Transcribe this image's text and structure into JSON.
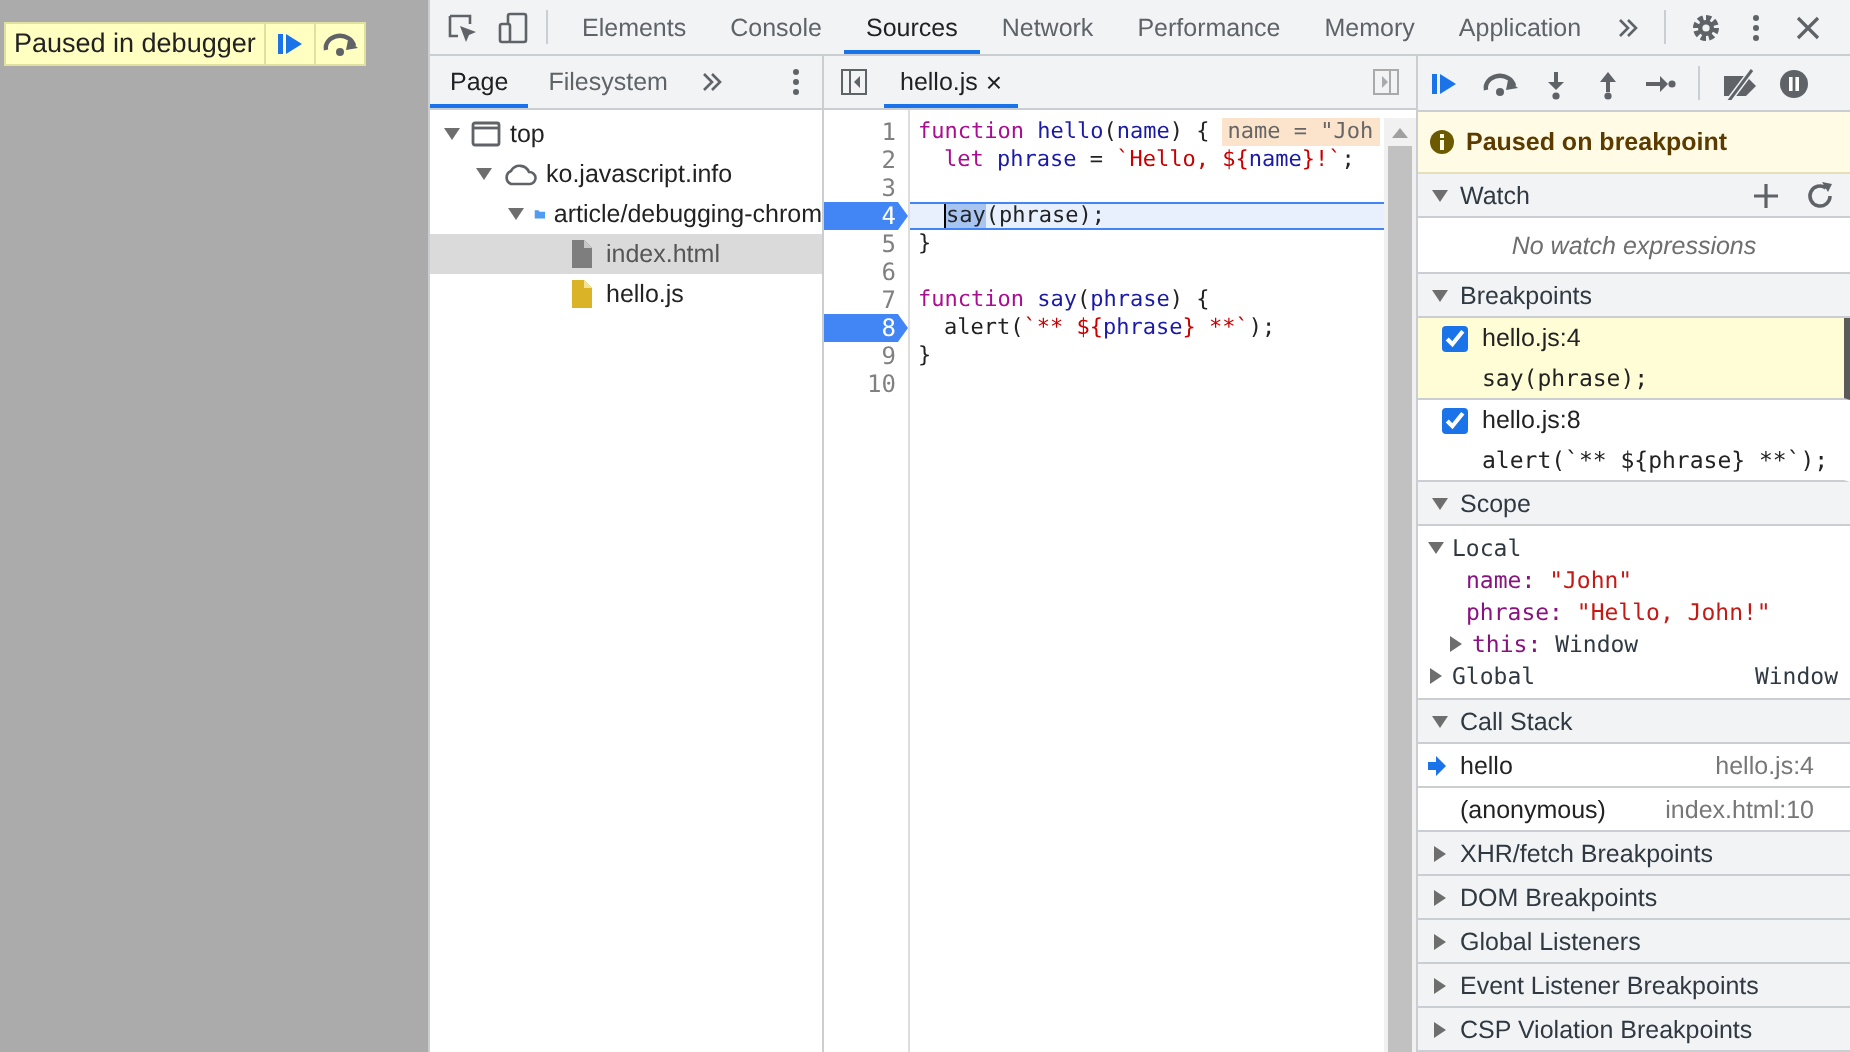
{
  "debugger_overlay": {
    "label": "Paused in debugger"
  },
  "main_tabs": [
    {
      "label": "Elements",
      "selected": false
    },
    {
      "label": "Console",
      "selected": false
    },
    {
      "label": "Sources",
      "selected": true
    },
    {
      "label": "Network",
      "selected": false
    },
    {
      "label": "Performance",
      "selected": false
    },
    {
      "label": "Memory",
      "selected": false
    },
    {
      "label": "Application",
      "selected": false
    }
  ],
  "navigator": {
    "tabs": [
      {
        "label": "Page",
        "selected": true
      },
      {
        "label": "Filesystem",
        "selected": false
      }
    ],
    "tree": [
      {
        "kind": "frame",
        "label": "top",
        "expanded": true,
        "selected": false,
        "children": [
          {
            "kind": "domain",
            "label": "ko.javascript.info",
            "expanded": true,
            "selected": false,
            "children": [
              {
                "kind": "folder",
                "label": "article/debugging-chrom",
                "expanded": true,
                "selected": false,
                "children": [
                  {
                    "kind": "document",
                    "label": "index.html",
                    "selected": true
                  },
                  {
                    "kind": "script",
                    "label": "hello.js",
                    "selected": false
                  }
                ]
              }
            ]
          }
        ]
      }
    ]
  },
  "editor": {
    "tabs": [
      {
        "label": "hello.js",
        "close": "×",
        "selected": true
      }
    ],
    "lines": [
      {
        "number": "1",
        "breakpoint": false,
        "current": false,
        "inline_value": "name = \"Joh",
        "tokens": [
          {
            "kind": "keyword",
            "text": "function "
          },
          {
            "kind": "variable",
            "text": "hello"
          },
          {
            "kind": "plain",
            "text": "("
          },
          {
            "kind": "variable",
            "text": "name"
          },
          {
            "kind": "plain",
            "text": ") {"
          }
        ]
      },
      {
        "number": "2",
        "breakpoint": false,
        "current": false,
        "indented": true,
        "tokens": [
          {
            "kind": "keyword",
            "text": "let "
          },
          {
            "kind": "variable",
            "text": "phrase"
          },
          {
            "kind": "plain",
            "text": " = "
          },
          {
            "kind": "string",
            "text": "`Hello, ${"
          },
          {
            "kind": "variable",
            "text": "name"
          },
          {
            "kind": "string",
            "text": "}!`"
          },
          {
            "kind": "plain",
            "text": ";"
          }
        ]
      },
      {
        "number": "3",
        "breakpoint": false,
        "current": false
      },
      {
        "number": "4",
        "breakpoint": true,
        "current": true,
        "indented": true,
        "tokens": [
          {
            "kind": "selection",
            "text": "say"
          },
          {
            "kind": "plain",
            "text": "(phrase);"
          }
        ]
      },
      {
        "number": "5",
        "breakpoint": false,
        "current": false,
        "tokens": [
          {
            "kind": "plain",
            "text": "}"
          }
        ]
      },
      {
        "number": "6",
        "breakpoint": false,
        "current": false
      },
      {
        "number": "7",
        "breakpoint": false,
        "current": false,
        "tokens": [
          {
            "kind": "keyword",
            "text": "function "
          },
          {
            "kind": "variable",
            "text": "say"
          },
          {
            "kind": "plain",
            "text": "("
          },
          {
            "kind": "variable",
            "text": "phrase"
          },
          {
            "kind": "plain",
            "text": ") {"
          }
        ]
      },
      {
        "number": "8",
        "breakpoint": true,
        "current": false,
        "indented": true,
        "tokens": [
          {
            "kind": "plain",
            "text": "alert("
          },
          {
            "kind": "string",
            "text": "`** ${"
          },
          {
            "kind": "variable",
            "text": "phrase"
          },
          {
            "kind": "string",
            "text": "} **`"
          },
          {
            "kind": "plain",
            "text": ");"
          }
        ]
      },
      {
        "number": "9",
        "breakpoint": false,
        "current": false,
        "tokens": [
          {
            "kind": "plain",
            "text": "}"
          }
        ]
      },
      {
        "number": "10",
        "breakpoint": false,
        "current": false
      }
    ]
  },
  "sidebar": {
    "banner": "Paused on breakpoint",
    "sections": [
      {
        "kind": "watch",
        "title": "Watch",
        "expanded": true,
        "empty_text": "No watch expressions"
      },
      {
        "kind": "breakpoints",
        "title": "Breakpoints",
        "expanded": true,
        "items": [
          {
            "location": "hello.js:4",
            "code": "say(phrase);",
            "checked": true,
            "highlighted": true
          },
          {
            "location": "hello.js:8",
            "code": "alert(`** ${phrase} **`);",
            "checked": true,
            "highlighted": false
          }
        ]
      },
      {
        "kind": "scope",
        "title": "Scope",
        "expanded": true,
        "scopes": [
          {
            "label": "Local",
            "expanded": true,
            "properties": [
              {
                "name": "name:",
                "value": "\"John\"",
                "kind": "string"
              },
              {
                "name": "phrase:",
                "value": "\"Hello, John!\"",
                "kind": "string"
              },
              {
                "name": "this:",
                "value": "Window",
                "kind": "object",
                "expanded": false
              }
            ]
          },
          {
            "label": "Global",
            "expanded": false,
            "summary": "Window"
          }
        ]
      },
      {
        "kind": "callstack",
        "title": "Call Stack",
        "expanded": true,
        "frames": [
          {
            "name": "hello",
            "location": "hello.js:4",
            "current": true
          },
          {
            "name": "(anonymous)",
            "location": "index.html:10",
            "current": false
          }
        ]
      },
      {
        "kind": "plain",
        "title": "XHR/fetch Breakpoints",
        "expanded": false
      },
      {
        "kind": "plain",
        "title": "DOM Breakpoints",
        "expanded": false
      },
      {
        "kind": "plain",
        "title": "Global Listeners",
        "expanded": false
      },
      {
        "kind": "plain",
        "title": "Event Listener Breakpoints",
        "expanded": false
      },
      {
        "kind": "plain",
        "title": "CSP Violation Breakpoints",
        "expanded": false
      }
    ]
  }
}
